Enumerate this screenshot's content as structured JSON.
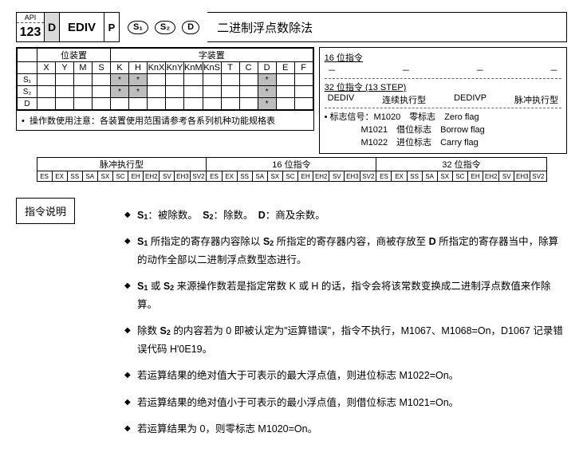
{
  "header": {
    "api": "API",
    "num": "123",
    "d": "D",
    "mnemonic": "EDIV",
    "p": "P",
    "ops": [
      "S₁",
      "S₂",
      "D"
    ],
    "title": "二进制浮点数除法"
  },
  "appl": {
    "bitHdr": "位装置",
    "wordHdr": "字装置",
    "cols": [
      "X",
      "Y",
      "M",
      "S",
      "K",
      "H",
      "KnX",
      "KnY",
      "KnM",
      "KnS",
      "T",
      "C",
      "D",
      "E",
      "F"
    ],
    "rows": [
      {
        "name": "S₁",
        "marks": [
          4,
          5,
          12
        ]
      },
      {
        "name": "S₂",
        "marks": [
          4,
          5,
          12
        ]
      },
      {
        "name": "D",
        "marks": [
          12
        ]
      }
    ],
    "note": "操作数使用注意：各装置使用范围请参考各系列机种功能规格表"
  },
  "info": {
    "l16": "16 位指令",
    "dash": "－",
    "l32": "32 位指令 (13 STEP)",
    "modes": [
      "DEDIV",
      "连续执行型",
      "DEDIVP",
      "脉冲执行型"
    ],
    "flagLbl": "标志信号：",
    "f1": "M1020　零标志　Zero flag",
    "f2": "M1021　借位标志　Borrow flag",
    "f3": "M1022　进位标志　Carry flag"
  },
  "exec": {
    "hdrs": [
      "脉冲执行型",
      "16 位指令",
      "32 位指令"
    ],
    "cells": [
      "ES",
      "EX",
      "SS",
      "SA",
      "SX",
      "SC",
      "EH",
      "EH2",
      "SV",
      "EH3",
      "SV2"
    ]
  },
  "explainLbl": "指令说明",
  "bul": [
    "S₁：被除数。　S₂：除数。　D：商及余数。",
    "S₁ 所指定的寄存器内容除以 S₂ 所指定的寄存器内容，商被存放至 D 所指定的寄存器当中，除算的动作全部以二进制浮点数型态进行。",
    "S₁ 或 S₂ 来源操作数若是指定常数 K 或 H 的话，指令会将该常数变换成二进制浮点数值来作除算。",
    "除数 S₂ 的内容若为 0 即被认定为\"运算错误\"，指令不执行，M1067、M1068=On，D1067 记录错误代码 H'0E19。",
    "若运算结果的绝对值大于可表示的最大浮点值，则进位标志 M1022=On。",
    "若运算结果的绝对值小于可表示的最小浮点值，则借位标志 M1021=On。",
    "若运算结果为 0，则零标志 M1020=On。"
  ]
}
